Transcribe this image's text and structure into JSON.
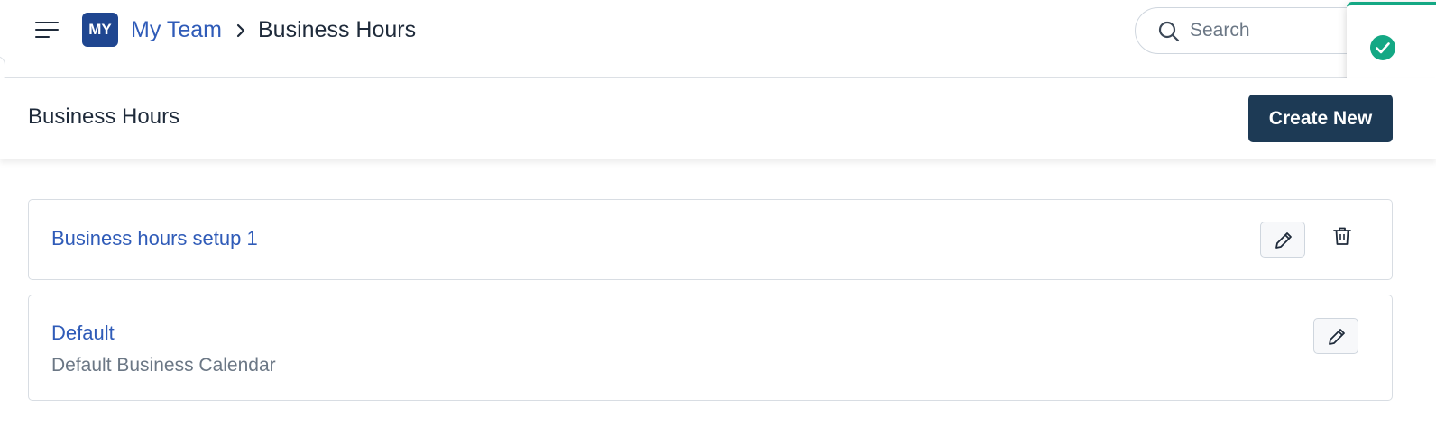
{
  "header": {
    "team_initials": "MY",
    "breadcrumb_team": "My Team",
    "breadcrumb_current": "Business Hours",
    "search_placeholder": "Search"
  },
  "page": {
    "title": "Business Hours",
    "create_button_label": "Create New"
  },
  "items": [
    {
      "title": "Business hours setup 1",
      "description": ""
    },
    {
      "title": "Default",
      "description": "Default Business Calendar"
    }
  ],
  "icons": {
    "menu": "hamburger-menu-icon",
    "breadcrumb_separator": "chevron-right-icon",
    "search": "search-icon",
    "toast": "check-circle-icon",
    "edit": "pencil-icon",
    "delete": "trash-icon"
  },
  "colors": {
    "brand": "#1f4690",
    "link": "#2f5bb8",
    "primary_button": "#1d3a55",
    "success": "#14a884"
  }
}
